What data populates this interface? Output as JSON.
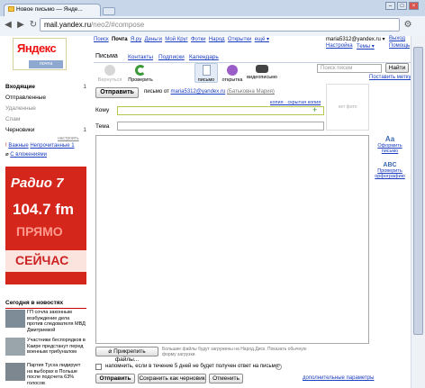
{
  "browser": {
    "tab_title": "Новое письмо — Янде...",
    "address_host": "mail.yandex.ru",
    "address_path": "/neo2/#compose"
  },
  "logo": {
    "name": "Яндекс",
    "sub": "почта"
  },
  "folders": [
    {
      "label": "Входящие",
      "count": "1"
    },
    {
      "label": "Отправленные",
      "count": ""
    },
    {
      "label": "Удаленные",
      "count": ""
    },
    {
      "label": "Спам",
      "count": ""
    },
    {
      "label": "Черновики",
      "count": "1"
    }
  ],
  "settings_link": "настроить",
  "filters": {
    "important": "Важные",
    "unread": "Непрочитанные 1",
    "attachments": "С вложениями"
  },
  "ad": {
    "logo": "Радио 7",
    "freq": "104.7 fm",
    "line1": "ПРЯМО",
    "line2": "СЕЙЧАС"
  },
  "news": {
    "title": "Сегодня в новостях",
    "items": [
      "ГП сочла законным возбуждение дела против следователя МВД Дмитриевой",
      "Участники беспорядков в Каире предстанут перед военным трибуналом",
      "Партия Тусха лидирует на выборах в Польше после подсчета 63% голосов"
    ]
  },
  "services": [
    "Поиск",
    "Почта",
    "Я.ру",
    "Деньги",
    "Мой Круг",
    "Фотки",
    "Народ",
    "Открытки",
    "ещё ▾"
  ],
  "user": {
    "email": "maria5312@yandex.ru ▾",
    "exit": "Выход",
    "settings": "Настройка",
    "themes": "Темы ▾",
    "help": "Помощь"
  },
  "tabs": [
    "Письма",
    "Контакты",
    "Подписки",
    "Календарь"
  ],
  "search": {
    "placeholder": "Поиск писем",
    "button": "Найти",
    "make_label": "Поставить метку"
  },
  "tools": {
    "back": "Вернуться",
    "check": "Проверить",
    "letter": "письмо",
    "card": "открытка",
    "video": "видеописьмо"
  },
  "compose": {
    "send": "Отправить",
    "from_label": "письмо от",
    "from_email": "maria5312@yandex.ru",
    "from_name": "(Батьковна Мария)",
    "cc_links": "копия · скрытая копия",
    "to_label": "Кому",
    "subject_label": "Тема",
    "photo_placeholder": "нет фото",
    "typograf": "Оформить письмо",
    "spell": "Проверить орфографию",
    "attach": "Прикрепить файлы...",
    "attach_note": "Большие файлы будут загружены на Народ.Диск. Показать обычную форму загрузки.",
    "remind": "напомнить, если в течение 5 дней не будет получен ответ на письмо",
    "send_bottom": "Отправить",
    "save_draft": "Сохранить как черновик",
    "cancel": "Отменить",
    "extra": "дополнительные параметры"
  }
}
